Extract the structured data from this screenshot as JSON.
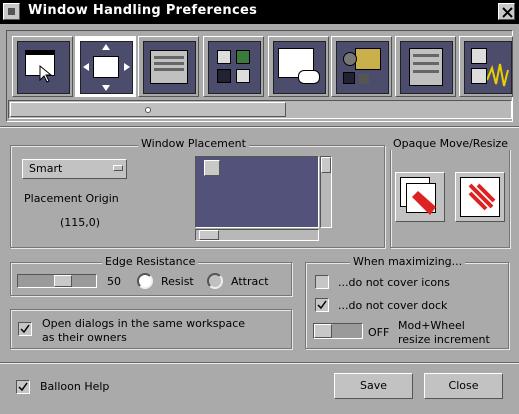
{
  "window": {
    "title": "Window Handling Preferences"
  },
  "toolbar": {
    "items": [
      {
        "name": "window-icon"
      },
      {
        "name": "move-arrows-icon"
      },
      {
        "name": "window-list-icon"
      },
      {
        "name": "apps-icon"
      },
      {
        "name": "text-input-icon"
      },
      {
        "name": "folder-icon"
      },
      {
        "name": "menu-window-icon"
      },
      {
        "name": "misc-icon"
      }
    ]
  },
  "placement": {
    "group_title": "Window Placement",
    "mode": "Smart",
    "origin_label": "Placement Origin",
    "origin_value": "(115,0)"
  },
  "opaque": {
    "group_title": "Opaque Move/Resize"
  },
  "edge": {
    "group_title": "Edge Resistance",
    "value": "50",
    "resist_label": "Resist",
    "attract_label": "Attract",
    "selected": "Resist"
  },
  "dialogs": {
    "label_line1": "Open dialogs in the same workspace",
    "label_line2": "as their owners",
    "checked": true
  },
  "maximize": {
    "group_title": "When maximizing...",
    "icons_label": "...do not cover icons",
    "icons_checked": false,
    "dock_label": "...do not cover dock",
    "dock_checked": true,
    "wheel_value": "OFF",
    "wheel_label_line1": "Mod+Wheel",
    "wheel_label_line2": "resize increment"
  },
  "footer": {
    "balloon_label": "Balloon Help",
    "balloon_checked": true,
    "save_label": "Save",
    "close_label": "Close"
  },
  "colors": {
    "background": "#aaaaaa",
    "titlebar": "#000000",
    "preview": "#52527a"
  }
}
